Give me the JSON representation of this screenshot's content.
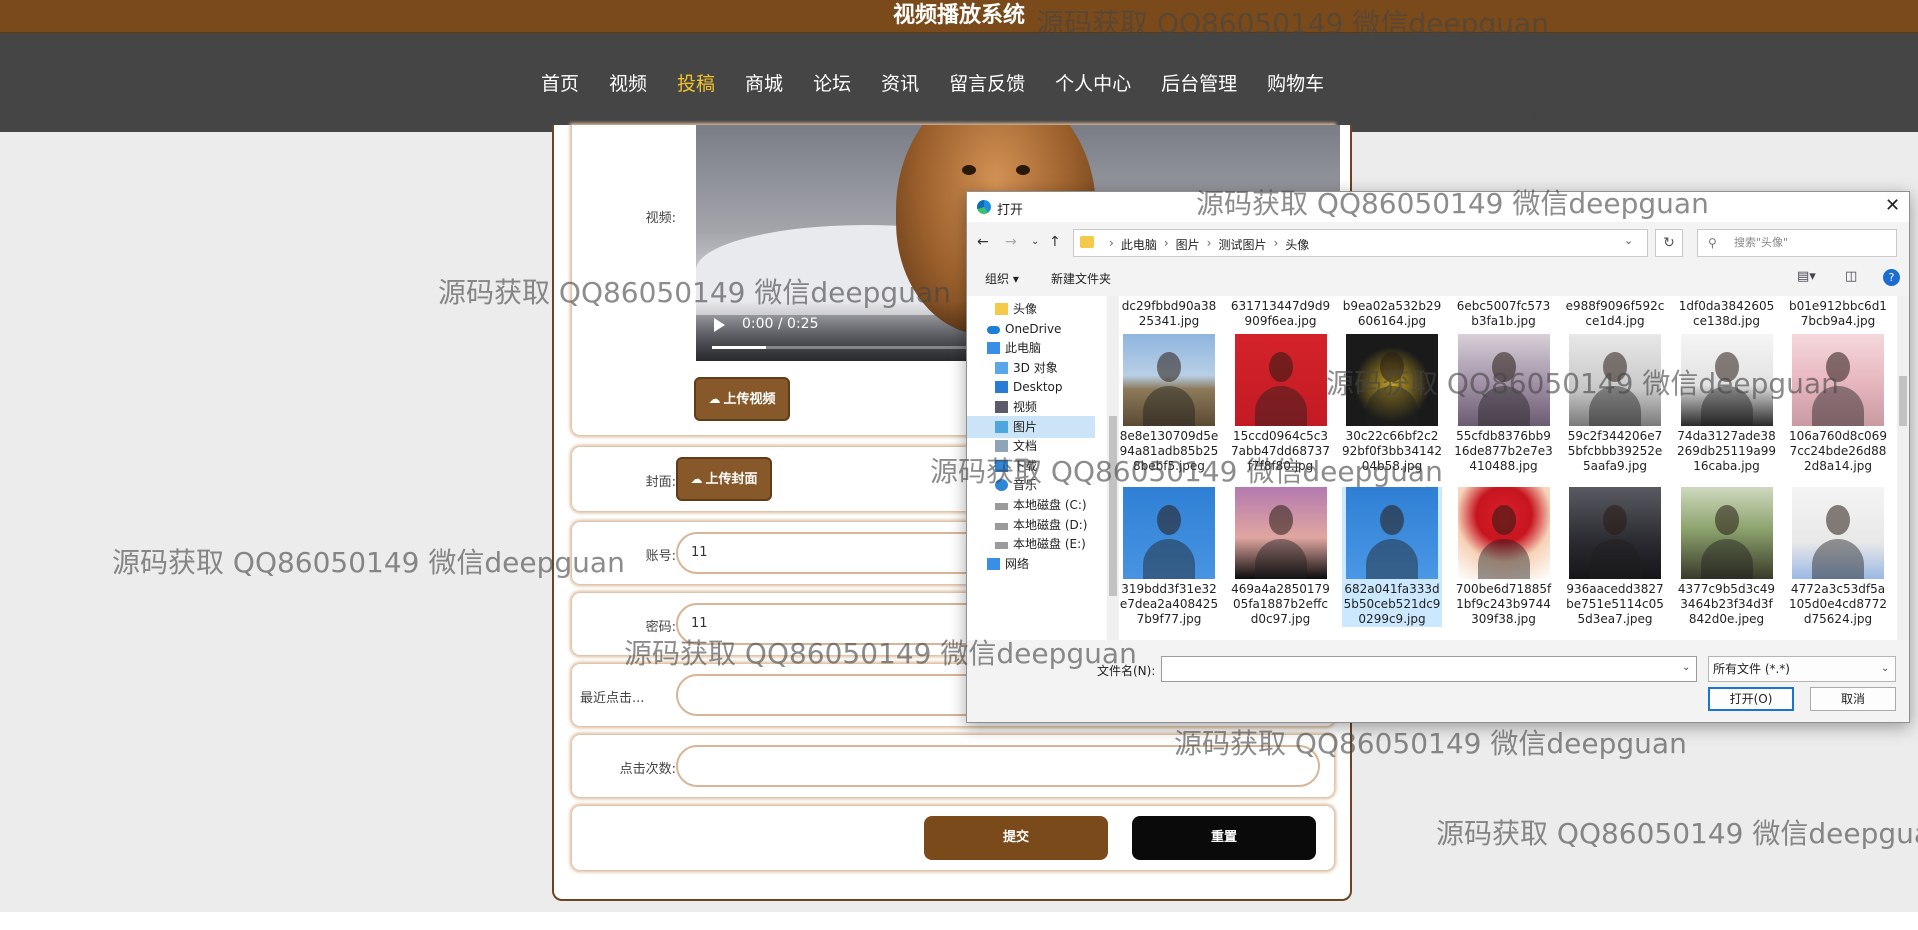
{
  "header": {
    "title": "视频播放系统"
  },
  "nav": {
    "items": [
      "首页",
      "视频",
      "投稿",
      "商城",
      "论坛",
      "资讯",
      "留言反馈",
      "个人中心",
      "后台管理",
      "购物车"
    ],
    "active_index": 2,
    "active_color": "#f0c12a"
  },
  "form": {
    "video_label": "视频:",
    "video_time": "0:00 / 0:25",
    "video_progress": 0.09,
    "upload_video_button": "上传视频",
    "cover_label": "封面:",
    "upload_cover_button": "上传封面",
    "account_label": "账号:",
    "account_value": "11",
    "password_label": "密码:",
    "password_value": "11",
    "recent_click_label": "最近点击...",
    "click_count_label": "点击次数:",
    "submit_button": "提交",
    "reset_button": "重置"
  },
  "dialog": {
    "title": "打开",
    "close_symbol": "✕",
    "breadcrumbs": [
      "此电脑",
      "图片",
      "测试图片",
      "头像"
    ],
    "search_placeholder": "搜索\"头像\"",
    "organize_button": "组织 ▾",
    "new_folder_button": "新建文件夹",
    "help_symbol": "?",
    "tree": [
      {
        "label": "头像",
        "icon": "folder-icon"
      },
      {
        "label": "OneDrive",
        "icon": "onedrive-icon"
      },
      {
        "label": "此电脑",
        "icon": "computer-icon"
      },
      {
        "label": "3D 对象",
        "icon": "3d-objects-icon"
      },
      {
        "label": "Desktop",
        "icon": "desktop-icon"
      },
      {
        "label": "视频",
        "icon": "video-folder-icon"
      },
      {
        "label": "图片",
        "icon": "pictures-folder-icon"
      },
      {
        "label": "文档",
        "icon": "documents-folder-icon"
      },
      {
        "label": "下载",
        "icon": "download-icon"
      },
      {
        "label": "音乐",
        "icon": "music-icon"
      },
      {
        "label": "本地磁盘 (C:)",
        "icon": "drive-icon"
      },
      {
        "label": "本地磁盘 (D:)",
        "icon": "drive-icon"
      },
      {
        "label": "本地磁盘 (E:)",
        "icon": "drive-icon"
      },
      {
        "label": "网络",
        "icon": "network-icon"
      }
    ],
    "top_row_names": [
      "dc29fbbd90a3825341.jpg",
      "631713447d9d9909f6ea.jpg",
      "b9ea02a532b29606164.jpg",
      "6ebc5007fc573b3fa1b.jpg",
      "e988f9096f592cce1d4.jpg",
      "1df0da3842605ce138d.jpg",
      "b01e912bbc6d17bcb9a4.jpg"
    ],
    "files": [
      {
        "name": "8e8e130709d5e94a81adb85b258bebf5.jpeg"
      },
      {
        "name": "15ccd0964c5c37abb47dd68737f7f8f80.jpg"
      },
      {
        "name": "30c22c66bf2c292bf0f3bb3414204b58.jpg"
      },
      {
        "name": "55cfdb8376bb916de877b2e7e3410488.jpg"
      },
      {
        "name": "59c2f344206e75bfcbbb39252e5aafa9.jpg"
      },
      {
        "name": "74da3127ade38269db25119a9916caba.jpg"
      },
      {
        "name": "106a760d8c0697cc24bde26d882d8a14.jpg"
      },
      {
        "name": "319bdd3f31e32e7dea2a4084257b9f77.jpg"
      },
      {
        "name": "469a4a285017905fa1887b2effcd0c97.jpg"
      },
      {
        "name": "682a041fa333d5b50ceb521dc90299c9.jpg"
      },
      {
        "name": "700be6d71885f1bf9c243b9744309f38.jpg"
      },
      {
        "name": "936aacedd3827be751e5114c055d3ea7.jpeg"
      },
      {
        "name": "4377c9b5d3c493464b23f34d3f842d0e.jpeg"
      },
      {
        "name": "4772a3c53df5a105d0e4cd8772d75624.jpg"
      }
    ],
    "selected_file_index": 9,
    "filename_label": "文件名(N):",
    "filename_value": "",
    "filetype_value": "所有文件 (*.*)",
    "open_button": "打开(O)",
    "cancel_button": "取消"
  },
  "watermark_text": "源码获取 QQ86050149 微信deepguan"
}
